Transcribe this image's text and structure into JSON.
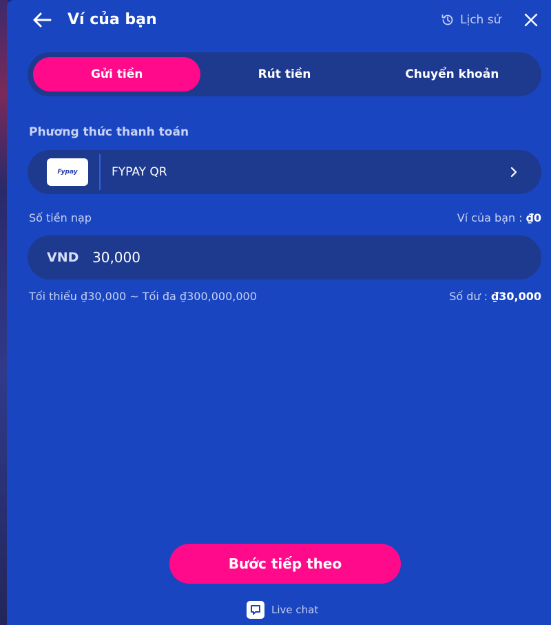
{
  "header": {
    "title": "Ví của bạn",
    "history_label": "Lịch sử"
  },
  "tabs": [
    {
      "label": "Gửi tiền",
      "active": true
    },
    {
      "label": "Rút tiền",
      "active": false
    },
    {
      "label": "Chuyển khoản",
      "active": false
    }
  ],
  "payment": {
    "section_label": "Phương thức thanh toán",
    "logo_text": "Fypay",
    "method_name": "FYPAY QR"
  },
  "amount": {
    "label": "Số tiền nạp",
    "wallet_label": "Ví của bạn :",
    "wallet_value": "₫0",
    "currency": "VND",
    "value": "30,000",
    "limits": "Tối thiểu ₫30,000 ~ Tối đa ₫300,000,000",
    "balance_label": "Số dư :",
    "balance_value": "₫30,000"
  },
  "footer": {
    "next_label": "Bước tiếp theo",
    "live_chat_label": "Live chat"
  },
  "colors": {
    "panel_bg": "#1a45c0",
    "field_bg": "#1e3a8f",
    "accent": "#ff0a8a"
  }
}
